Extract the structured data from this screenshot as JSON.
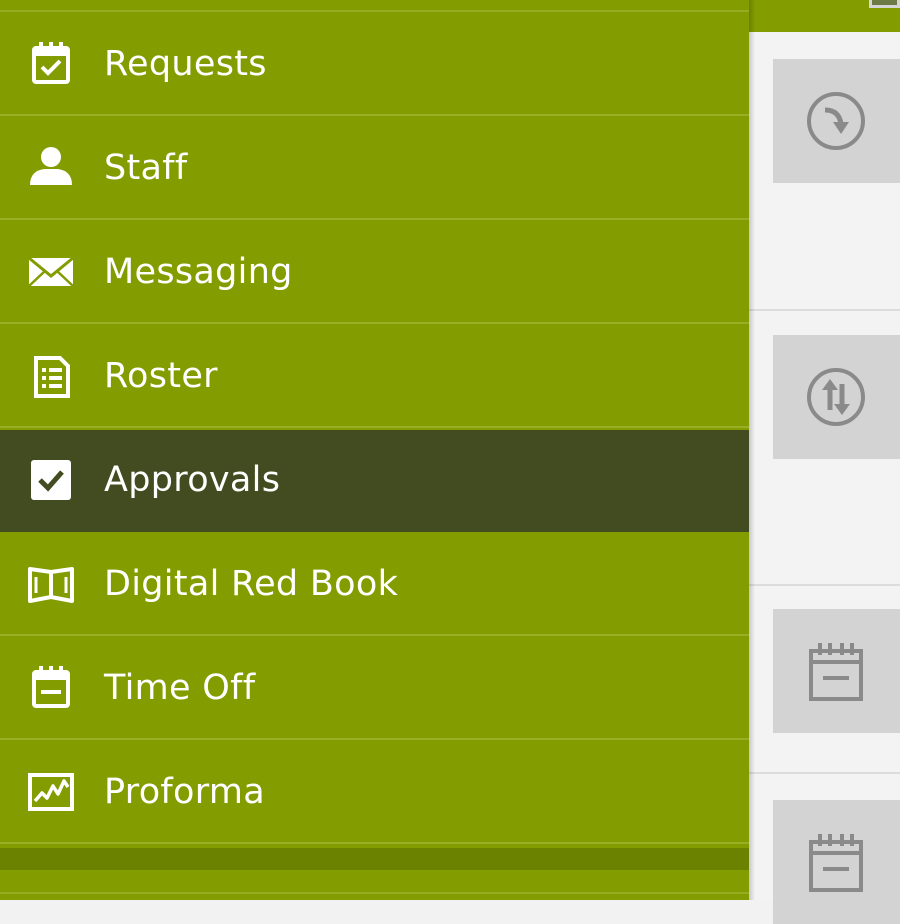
{
  "drawer": {
    "items": [
      {
        "label": "Requests",
        "icon": "calendar-check-icon",
        "selected": false
      },
      {
        "label": "Staff",
        "icon": "person-icon",
        "selected": false
      },
      {
        "label": "Messaging",
        "icon": "envelope-icon",
        "selected": false
      },
      {
        "label": "Roster",
        "icon": "clipboard-list-icon",
        "selected": false
      },
      {
        "label": "Approvals",
        "icon": "checkbox-icon",
        "selected": true
      },
      {
        "label": "Digital Red Book",
        "icon": "open-book-icon",
        "selected": false
      },
      {
        "label": "Time Off",
        "icon": "calendar-minus-icon",
        "selected": false
      },
      {
        "label": "Proforma",
        "icon": "chart-icon",
        "selected": false
      }
    ]
  },
  "content": {
    "cards": [
      {
        "icon": "circle-arrow-down-icon"
      },
      {
        "icon": "circle-swap-arrows-icon"
      },
      {
        "icon": "calendar-minus-icon"
      },
      {
        "icon": "calendar-minus-icon"
      }
    ]
  },
  "colors": {
    "drawer_bg": "#839c00",
    "drawer_selected": "#434c21",
    "drawer_divider": "#6b8200",
    "content_bg": "#f3f3f3",
    "thumb_bg": "#d3d3d3",
    "thumb_icon": "#8a8a8a"
  }
}
